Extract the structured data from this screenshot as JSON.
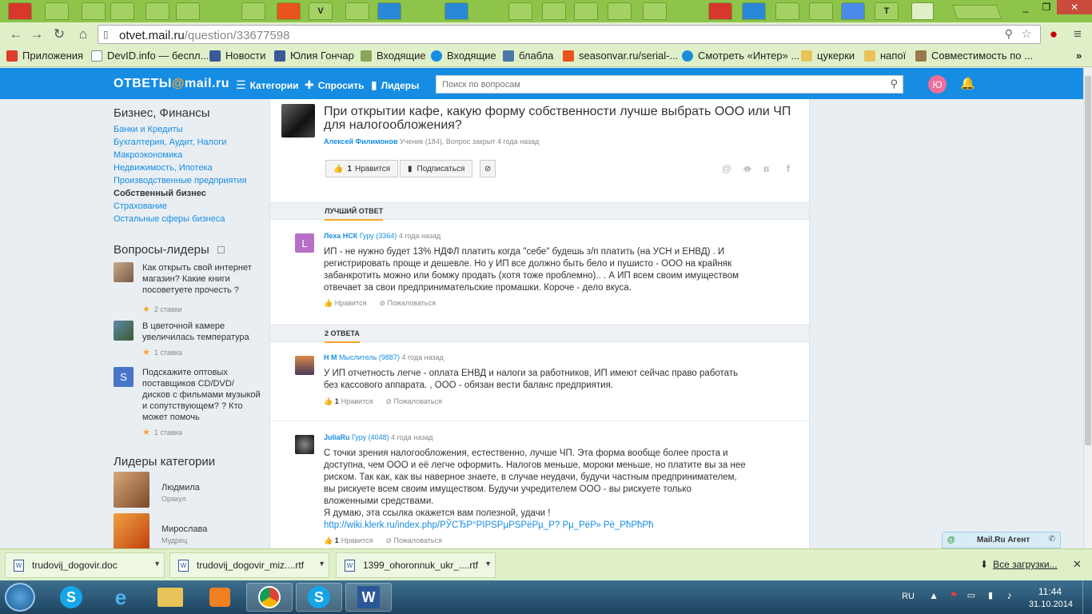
{
  "browser": {
    "url_host": "otvet.mail.ru",
    "url_path": "/question/33677598",
    "window_controls": [
      "_",
      "❐",
      "✕"
    ]
  },
  "bookmarks": [
    {
      "label": "Приложения",
      "color": "#e03b2b"
    },
    {
      "label": "DevID.info — беспл...",
      "color": "#ffffff"
    },
    {
      "label": "Новости",
      "color": "#3b5998"
    },
    {
      "label": "Юлия Гончар",
      "color": "#3b5998"
    },
    {
      "label": "Входящие",
      "color": "#8aa65a"
    },
    {
      "label": "Входящие",
      "color": "#168de2"
    },
    {
      "label": "блабла",
      "color": "#4a76a8"
    },
    {
      "label": "seasonvar.ru/serial-...",
      "color": "#e8541c"
    },
    {
      "label": "Смотреть «Интер» ...",
      "color": "#1a8fd8"
    },
    {
      "label": "цукерки",
      "color": "#e8c35a"
    },
    {
      "label": "напої",
      "color": "#e8c35a"
    },
    {
      "label": "Совместимость по ...",
      "color": "#9a7a4a"
    }
  ],
  "site": {
    "logo_prefix": "ОТВЕТЫ",
    "logo_at": "@",
    "logo_suffix": "mail.ru",
    "nav_categories": "Категории",
    "nav_ask": "Спросить",
    "nav_leaders": "Лидеры",
    "search_placeholder": "Поиск по вопросам",
    "avatar_letter": "Ю"
  },
  "sidebar": {
    "category_title": "Бизнес, Финансы",
    "links": [
      {
        "label": "Банки и Кредиты",
        "current": false
      },
      {
        "label": "Бухгалтерия, Аудит, Налоги",
        "current": false
      },
      {
        "label": "Макроэкономика",
        "current": false
      },
      {
        "label": "Недвижимость, Ипотека",
        "current": false
      },
      {
        "label": "Производственные предприятия",
        "current": false
      },
      {
        "label": "Собственный бизнес",
        "current": true
      },
      {
        "label": "Страхование",
        "current": false
      },
      {
        "label": "Остальные сферы бизнеса",
        "current": false
      }
    ],
    "leader_questions_title": "Вопросы-лидеры",
    "leader_questions": [
      {
        "text": "Как открыть свой интернет магазин? Какие книги посоветуете прочесть ?",
        "bets": "2 ставки"
      },
      {
        "text": "В цветочной камере увеличилась температура",
        "bets": "1 ставка"
      },
      {
        "text": "Подскажите оптовых поставщиков CD/DVD/ дисков с фильмами музыкой и сопутствующем? ? Кто может помочь",
        "bets": "1 ставка"
      }
    ],
    "category_leaders_title": "Лидеры категории",
    "category_leaders": [
      {
        "name": "Людмила",
        "rank": "Оракул"
      },
      {
        "name": "Мирослава",
        "rank": "Мудрец"
      }
    ]
  },
  "question": {
    "title": "При открытии кафе, какую форму собственности лучше выбрать ООО или ЧП для налогообложения?",
    "author": "Алексей Филимонов",
    "author_rank": "Ученик (184),",
    "status": "Вопрос закрыт 4 года назад",
    "like_count": "1",
    "like_label": "Нравится",
    "subscribe_label": "Подписаться",
    "share_icons": [
      "@",
      "ok",
      "в",
      "f"
    ]
  },
  "best_answer": {
    "section_label": "ЛУЧШИЙ ОТВЕТ",
    "avatar_letter": "L",
    "author": "Леха НСК",
    "rank": "Гуру (3364)",
    "time": "4 года назад",
    "text": "ИП - не нужно будет 13% НДФЛ платить когда \"себе\" будешь з/п платить (на УСН и ЕНВД) . И регистрировать проще и дешевле. Но у ИП все должно быть бело и пушисто - ООО на крайняк забанкротить можно или бомжу продать (хотя тоже проблемно).. . А ИП всем своим имуществом отвечает за свои предпринимательские промашки. Короче - дело вкуса.",
    "like_label": "Нравится",
    "complain_label": "Пожаловаться"
  },
  "answers_section_label": "2 ОТВЕТА",
  "answers": [
    {
      "author": "Н М",
      "rank": "Мыслитель (9887)",
      "time": "4 года назад",
      "text": "У ИП отчетность легче - оплата ЕНВД и налоги за работников, ИП имеют сейчас право работать без кассового аппарата. , ООО - обязан вести баланс предприятия.",
      "like_count": "1",
      "like_label": "Нравится",
      "complain_label": "Пожаловаться"
    },
    {
      "author": "JuliaRu",
      "rank": "Гуру (4048)",
      "time": "4 года назад",
      "text": "С точки зрения налогообложения, естественно, лучше ЧП. Эта форма вообще более проста и доступна, чем ООО и её легче оформить. Налогов меньше, мороки меньше, но платите вы за нее риском. Так как, как вы наверное знаете, в случае неудачи, будучи частным предпринимателем, вы рискуете всем своим имуществом. Будучи учредителем ООО - вы рискуете только вложенными средствами.",
      "text2": "Я думаю, эта ссылка окажется вам полезной, удачи !",
      "link": "http://wiki.klerk.ru/index.php/РЎСЂР°РІРЅРµРЅРёРµ_Р? Рµ_РёР» Рё_РћРћРћ",
      "like_count": "1",
      "like_label": "Нравится",
      "complain_label": "Пожаловаться"
    }
  ],
  "agent_label": "Mail.Ru Агент",
  "downloads": {
    "items": [
      "trudovij_dogovir.doc",
      "trudovij_dogovir_miz....rtf",
      "1399_ohoronnuk_ukr_....rtf"
    ],
    "all_label": "Все загрузки..."
  },
  "tray": {
    "lang": "RU",
    "time": "11:44",
    "date": "31.10.2014"
  }
}
